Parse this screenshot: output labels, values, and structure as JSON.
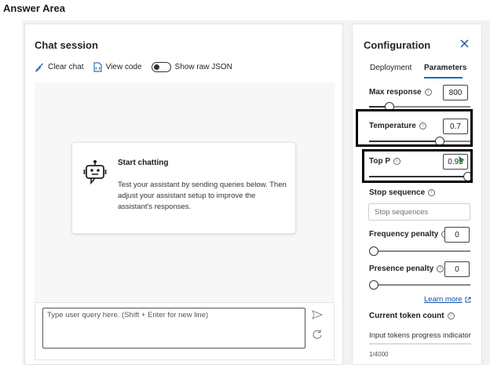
{
  "answer_area": {
    "title": "Answer Area"
  },
  "chat": {
    "title": "Chat session",
    "toolbar": {
      "clear_chat": "Clear chat",
      "view_code": "View code",
      "show_raw_json": "Show raw JSON"
    },
    "start_card": {
      "title": "Start chatting",
      "description": "Test your assistant by sending queries below. Then adjust your assistant setup to improve the assistant's responses."
    },
    "input": {
      "placeholder": "Type user query here. (Shift + Enter for new line)"
    }
  },
  "config": {
    "title": "Configuration",
    "tabs": [
      {
        "label": "Deployment",
        "active": false
      },
      {
        "label": "Parameters",
        "active": true
      }
    ],
    "params": {
      "max_response": {
        "label": "Max response",
        "value": "800",
        "slider_fraction": 0.2
      },
      "temperature": {
        "label": "Temperature",
        "value": "0.7",
        "slider_fraction": 0.7
      },
      "top_p": {
        "label": "Top P",
        "value": "0.95",
        "slider_fraction": 1.0
      },
      "stop_sequence": {
        "label": "Stop sequence",
        "placeholder": "Stop sequences"
      },
      "frequency_penalty": {
        "label": "Frequency penalty",
        "value": "0",
        "slider_fraction": 0.0
      },
      "presence_penalty": {
        "label": "Presence penalty",
        "value": "0",
        "slider_fraction": 0.0
      }
    },
    "learn_more": "Learn more",
    "token_count": {
      "title": "Current token count",
      "indicator_label": "Input tokens progress indicator",
      "count": "1/4000"
    }
  },
  "colors": {
    "accent": "#0f6cbd",
    "link": "#0f4fa8",
    "highlight_border": "#000000"
  }
}
